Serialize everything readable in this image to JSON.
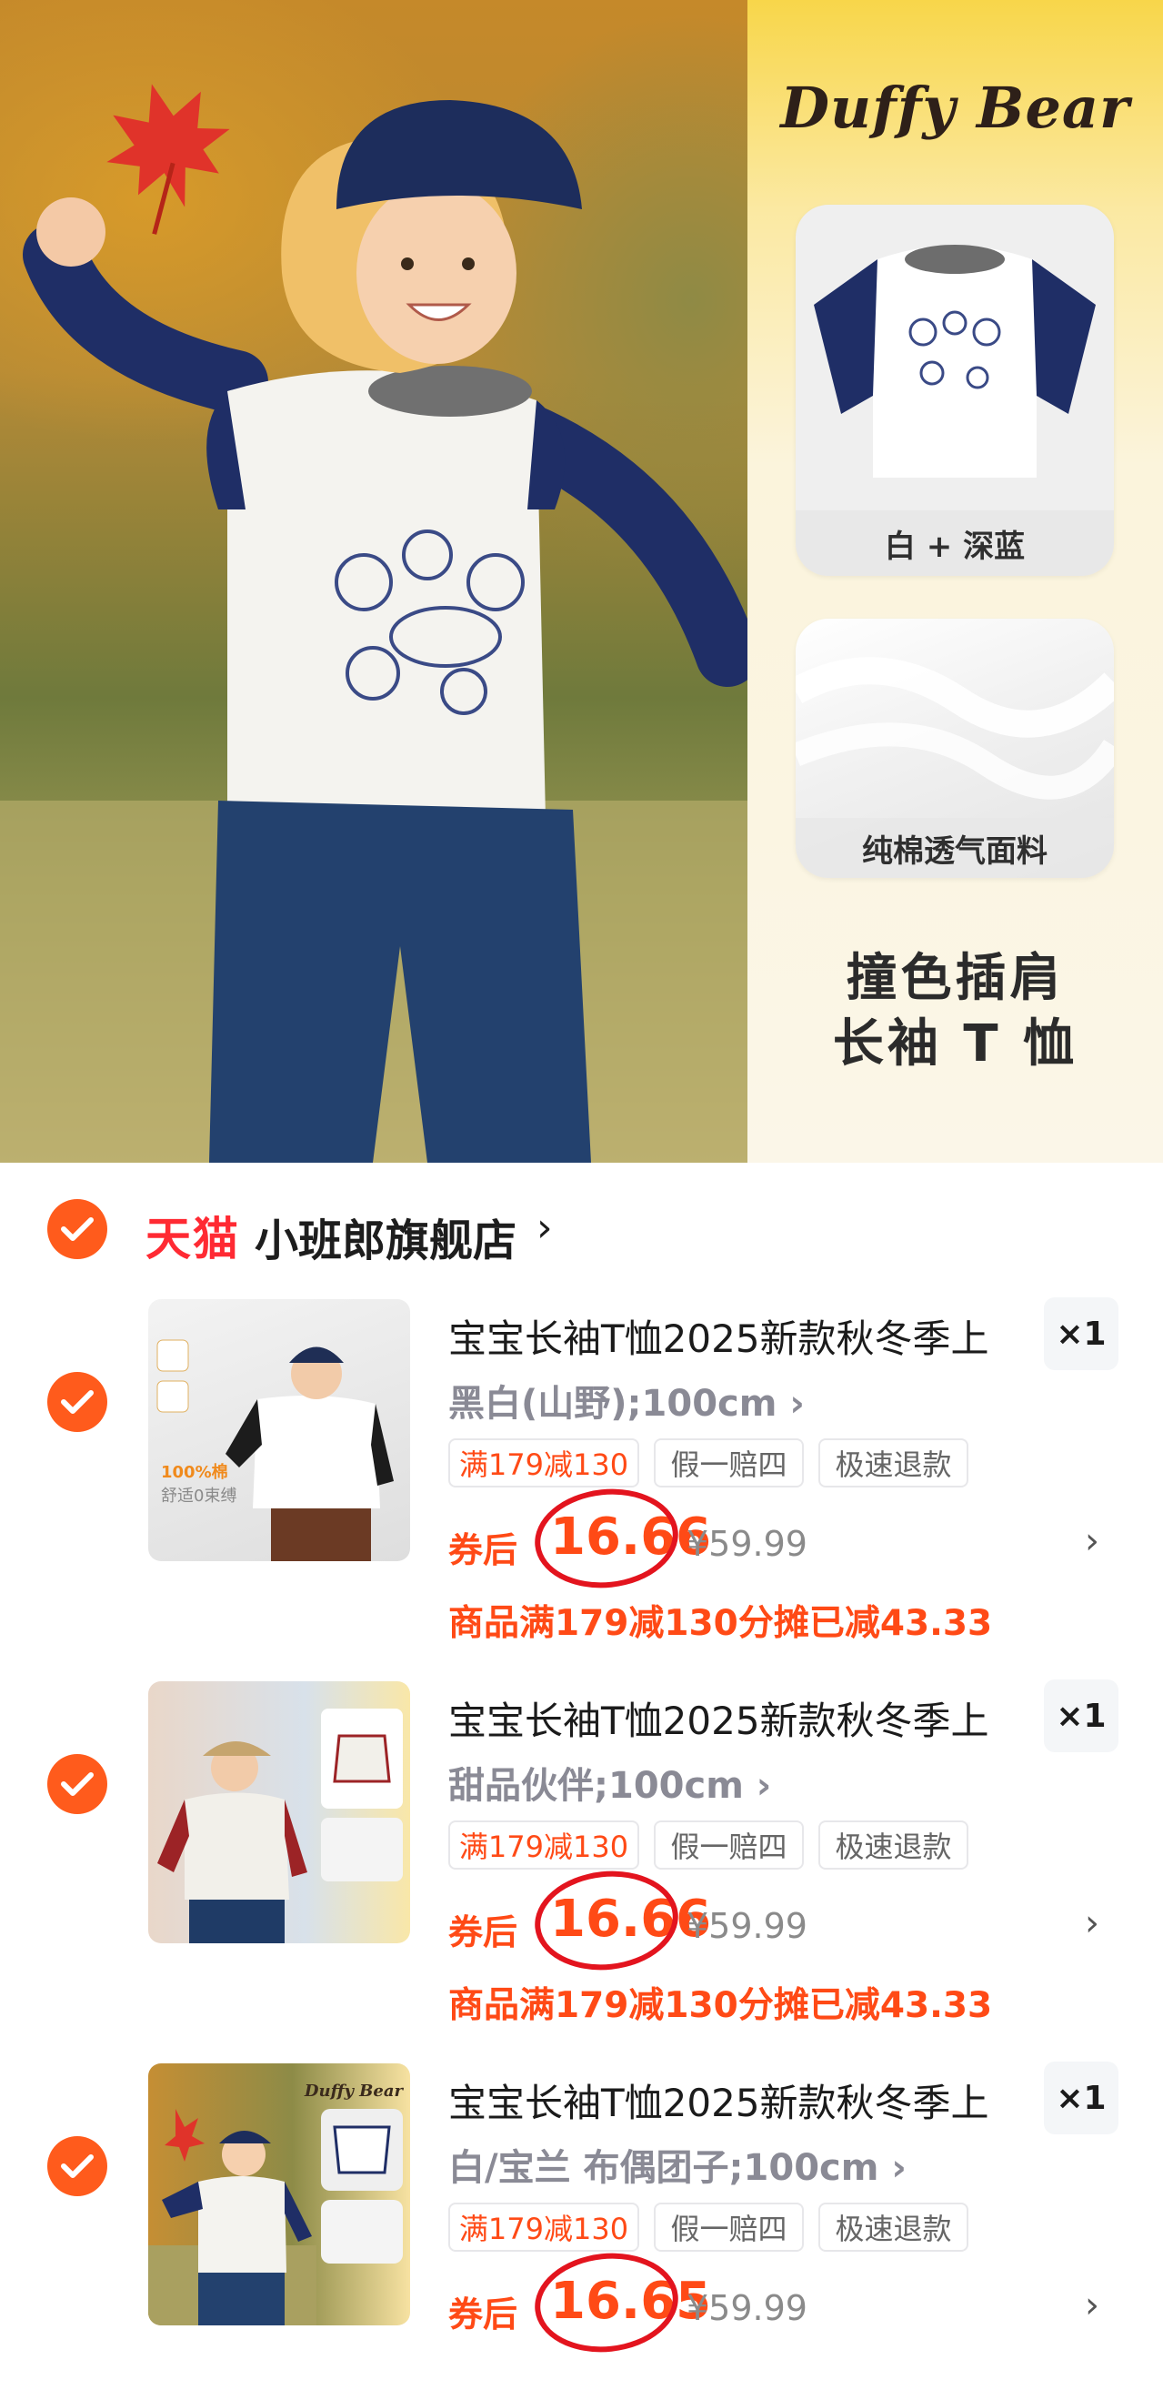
{
  "hero": {
    "brand": "Duffy Bear",
    "swatches": [
      {
        "label": "白 + 深蓝",
        "icon": "tshirt-navy-white-icon"
      },
      {
        "label": "纯棉透气面料",
        "icon": "cotton-fabric-icon"
      }
    ],
    "feature_line1": "撞色插肩",
    "feature_line2": "长袖 T 恤"
  },
  "store": {
    "platform": "天猫",
    "name": "小班郎旗舰店",
    "chevron": "›"
  },
  "items": [
    {
      "title": "宝宝长袖T恤2025新款秋冬季上",
      "spec": "黑白(山野);100cm ›",
      "qty": "×1",
      "tags": [
        "满179减130",
        "假一赔四",
        "极速退款"
      ],
      "coupon_label": "券后",
      "price": "16.66",
      "original_price": "¥59.99",
      "discount_note": "商品满179减130分摊已减43.33",
      "thumb_caption_1": "100%棉",
      "thumb_caption_2": "舒适0束缚"
    },
    {
      "title": "宝宝长袖T恤2025新款秋冬季上",
      "spec": "甜品伙伴;100cm ›",
      "qty": "×1",
      "tags": [
        "满179减130",
        "假一赔四",
        "极速退款"
      ],
      "coupon_label": "券后",
      "price": "16.66",
      "original_price": "¥59.99",
      "discount_note": "商品满179减130分摊已减43.33"
    },
    {
      "title": "宝宝长袖T恤2025新款秋冬季上",
      "spec": "白/宝兰 布偶团子;100cm ›",
      "qty": "×1",
      "tags": [
        "满179减130",
        "假一赔四",
        "极速退款"
      ],
      "coupon_label": "券后",
      "price": "16.65",
      "original_price": "¥59.99",
      "thumb_brand": "Duffy Bear"
    }
  ],
  "colors": {
    "accent": "#ff5b1c",
    "price": "#ff4a16",
    "tmall": "#ff2a33",
    "annotation": "#e3141e"
  }
}
